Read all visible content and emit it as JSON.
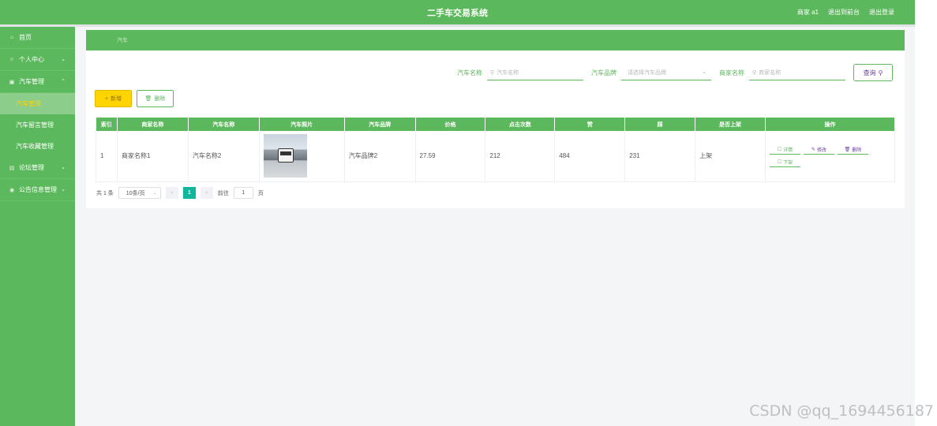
{
  "header": {
    "title": "二手车交易系统",
    "user_label": "商家 a1",
    "back_link": "退出到前台",
    "logout_link": "退出登录"
  },
  "sidebar": {
    "items": [
      {
        "label": "首页",
        "icon": "home-icon"
      },
      {
        "label": "个人中心",
        "icon": "user-icon",
        "arrow": "⌄"
      },
      {
        "label": "汽车管理",
        "icon": "car-icon",
        "arrow": "⌃",
        "children": [
          "汽车管理",
          "汽车留言管理",
          "汽车收藏管理"
        ]
      },
      {
        "label": "论坛管理",
        "icon": "forum-icon",
        "arrow": "⌄"
      },
      {
        "label": "公告信息管理",
        "icon": "notice-icon",
        "arrow": "⌄"
      }
    ]
  },
  "breadcrumb": {
    "current": "汽车"
  },
  "search": {
    "car_name_label": "汽车名称",
    "car_name_placeholder": "汽车名称",
    "brand_label": "汽车品牌",
    "brand_placeholder": "请选择汽车品牌",
    "merchant_label": "商家名称",
    "merchant_placeholder": "商家名称",
    "query_label": "查询"
  },
  "actions": {
    "add_label": "新增",
    "delete_label": "删除"
  },
  "table": {
    "headers": [
      "索引",
      "商家名称",
      "汽车名称",
      "汽车照片",
      "汽车品牌",
      "价格",
      "点击次数",
      "赞",
      "踩",
      "是否上架",
      "操作"
    ],
    "rows": [
      {
        "index": "1",
        "merchant": "商家名称1",
        "car_name": "汽车名称2",
        "brand": "汽车品牌2",
        "price": "27.59",
        "clicks": "212",
        "likes": "484",
        "dislikes": "231",
        "listed": "上架",
        "ops": {
          "detail": "详情",
          "edit": "修改",
          "delete": "删除",
          "unlist": "下架"
        }
      }
    ]
  },
  "pager": {
    "total": "共 1 条",
    "page_size": "10条/页",
    "prev": "‹",
    "current": "1",
    "next": "›",
    "goto_label": "前往",
    "goto_value": "1",
    "page_unit": "页"
  },
  "watermark": "CSDN @qq_1694456187",
  "colors": {
    "primary": "#5cb85c",
    "accent_yellow": "#ffd400",
    "pager_active": "#0fb89a"
  }
}
